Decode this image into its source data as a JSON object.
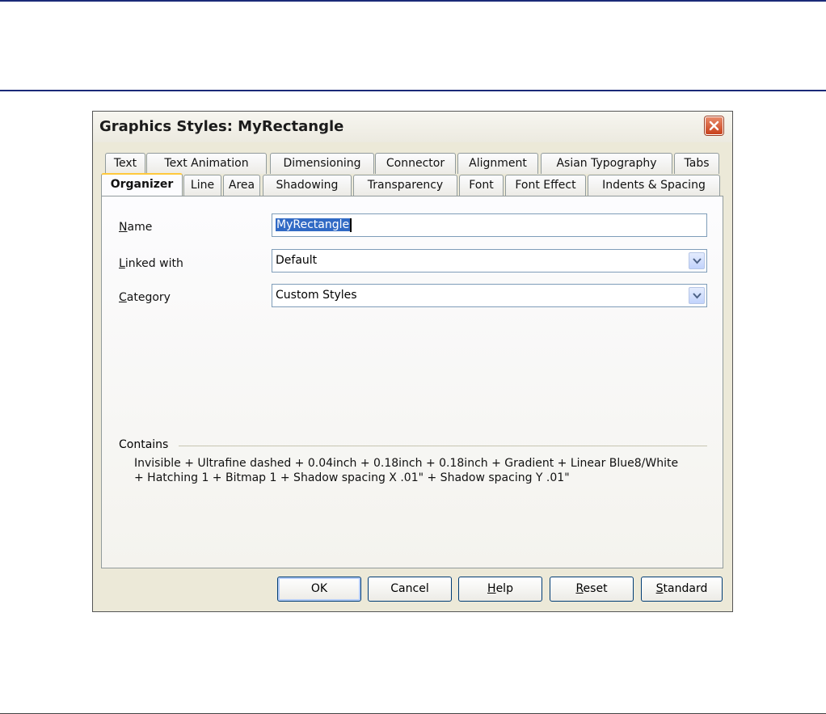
{
  "dialog": {
    "title": "Graphics Styles: MyRectangle",
    "close_icon": "close-icon"
  },
  "tabs": {
    "row1": [
      "Text",
      "Text Animation",
      "Dimensioning",
      "Connector",
      "Alignment",
      "Asian Typography",
      "Tabs"
    ],
    "row2": [
      "Organizer",
      "Line",
      "Area",
      "Shadowing",
      "Transparency",
      "Font",
      "Font Effect",
      "Indents & Spacing"
    ],
    "active": "Organizer"
  },
  "organizer": {
    "name": {
      "label_mnemonic": "N",
      "label_rest": "ame",
      "value": "MyRectangle"
    },
    "linked_with": {
      "label_mnemonic": "L",
      "label_rest": "inked with",
      "value": "Default"
    },
    "category": {
      "label_mnemonic": "C",
      "label_rest": "ategory",
      "value": "Custom Styles"
    },
    "contains": {
      "label": "Contains",
      "line1": "Invisible + Ultrafine dashed + 0.04inch + 0.18inch + 0.18inch + Gradient + Linear Blue8/White",
      "line2": "+ Hatching 1 + Bitmap 1 + Shadow spacing X .01\" + Shadow spacing Y .01\""
    }
  },
  "buttons": {
    "ok": "OK",
    "cancel": "Cancel",
    "help_mnemonic": "H",
    "help_rest": "elp",
    "reset_mnemonic": "R",
    "reset_rest": "eset",
    "standard_mnemonic": "S",
    "standard_rest": "tandard"
  },
  "colors": {
    "close_button": "#c8411c",
    "active_tab_accent": "#ffc83c",
    "selection": "#316ac5"
  }
}
